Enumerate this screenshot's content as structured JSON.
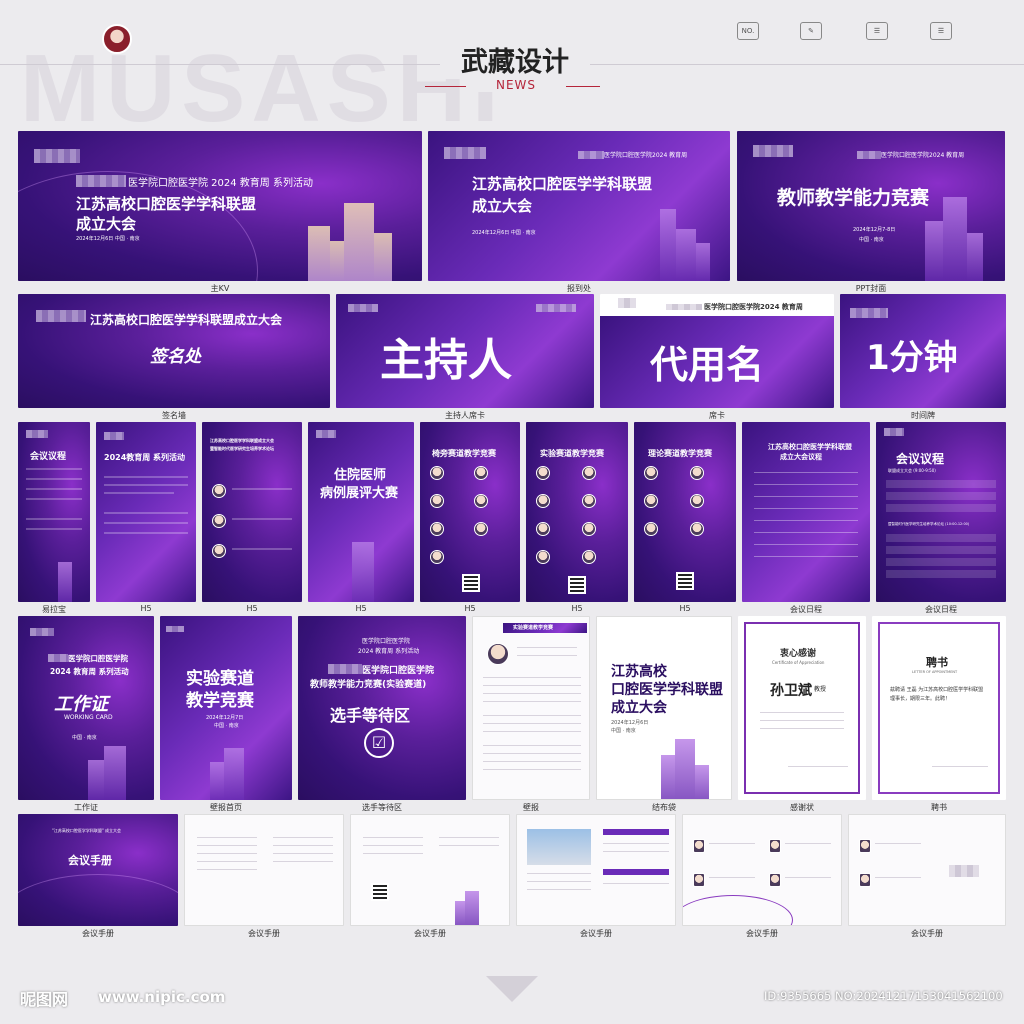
{
  "header": {
    "watermark": "MUSASHI",
    "brand": "武藏设计",
    "news": "NEWS",
    "icons": [
      "NO.",
      "edit-icon",
      "list-icon",
      "layers-icon"
    ]
  },
  "texts": {
    "event_series": "医学院口腔医学院 2024 教育周 系列活动",
    "event_series_bold": "医学院口腔医学院2024 教育周 系列活动",
    "event_week": "医学院口腔医学院2024 教育周",
    "alliance_title_1": "江苏高校口腔医学学科联盟",
    "alliance_title_2": "成立大会",
    "alliance_full": "江苏高校口腔医学学科联盟成立大会",
    "date_place_1": "2024年12月6日   中国 · 南京",
    "date_place_2": "2024年12月6日   中国 · 南京",
    "competition": "教师教学能力竞赛",
    "ppt_date": "2024年12月7-8日",
    "ppt_place": "中国 · 南京",
    "signature": "签名处",
    "host": "主持人",
    "name_placeholder": "代用名",
    "one_minute": "1分钟",
    "agenda": "会议议程",
    "h5_title_1": "2024教育周 系列活动",
    "h5_title_resident": "住院医师",
    "h5_title_resident_2": "病例展评大赛",
    "h5_chair": "椅旁赛道教学竞赛",
    "h5_lab": "实验赛道教学竞赛",
    "h5_theory": "理论赛道教学竞赛",
    "h5_forum_1": "江苏高校口腔医学学科联盟成立大会",
    "h5_forum_2": "暨智能时代医学研究生培养学术论坛",
    "agenda_alliance": "江苏高校口腔医学学科联盟",
    "agenda_alliance_2": "成立大会议程",
    "agenda_sub": "联盟成立大会 (9:00-9:50)",
    "agenda_sub2": "暨智能时代医学研究生培养学术论坛 (10:00-12:00)",
    "work_title_1": "医学院口腔医学院",
    "work_title_2": "2024 教育周 系列活动",
    "work_card": "工作证",
    "working_card_en": "WORKING CARD",
    "work_place": "中国 · 南京",
    "lab_title_1": "实验赛道",
    "lab_title_2": "教学竞赛",
    "lab_date": "2024年12月7日",
    "lab_place": "中国 · 南京",
    "wait_top_1": "医学院口腔医学院",
    "wait_top_2": "2024 教育周 系列活动",
    "wait_title_1": "医学院口腔医学院",
    "wait_title_2": "教师教学能力竞赛(实验赛道)",
    "wait_area": "选手等待区",
    "poster_head": "实验赛道教学竞赛",
    "bag_1": "江苏高校",
    "bag_2": "口腔医学学科联盟",
    "bag_3": "成立大会",
    "bag_date": "2024年12月6日",
    "bag_place": "中国 · 南京",
    "thanks_title": "衷心感谢",
    "thanks_en": "Certificate of Appreciation",
    "thanks_name": "孙卫斌",
    "thanks_role": "教授",
    "hire_title": "聘书",
    "hire_en": "LETTER OF APPOINTMENT",
    "hire_body": "兹聘请 王磊 为江苏高校口腔医学学科联盟理事长，期限三年。此聘！",
    "manual_title": "会议手册",
    "manual_sub": "\"江苏高校口腔医学学科联盟\" 成立大会"
  },
  "captions": {
    "main_kv": "主KV",
    "signin": "报到处",
    "ppt": "PPT封面",
    "sign_wall": "签名墙",
    "host_card": "主持人席卡",
    "seat_card": "席卡",
    "time_card": "时间牌",
    "rollup": "易拉宝",
    "h5": "H5",
    "agenda": "会议日程",
    "work": "工作证",
    "poster_cover": "壁报首页",
    "wait": "选手等待区",
    "poster": "壁报",
    "bag": "结布袋",
    "thanks": "感谢状",
    "hire": "聘书",
    "manual": "会议手册"
  },
  "footer": {
    "logo": "昵图网",
    "url": "www.nipic.com",
    "id": "ID:9355665 NO:20241217153041562100"
  },
  "colors": {
    "accent": "#b5253a",
    "purple_dark": "#2a0e60",
    "purple_mid": "#6a2bb8",
    "purple_light": "#8e3ad1"
  }
}
